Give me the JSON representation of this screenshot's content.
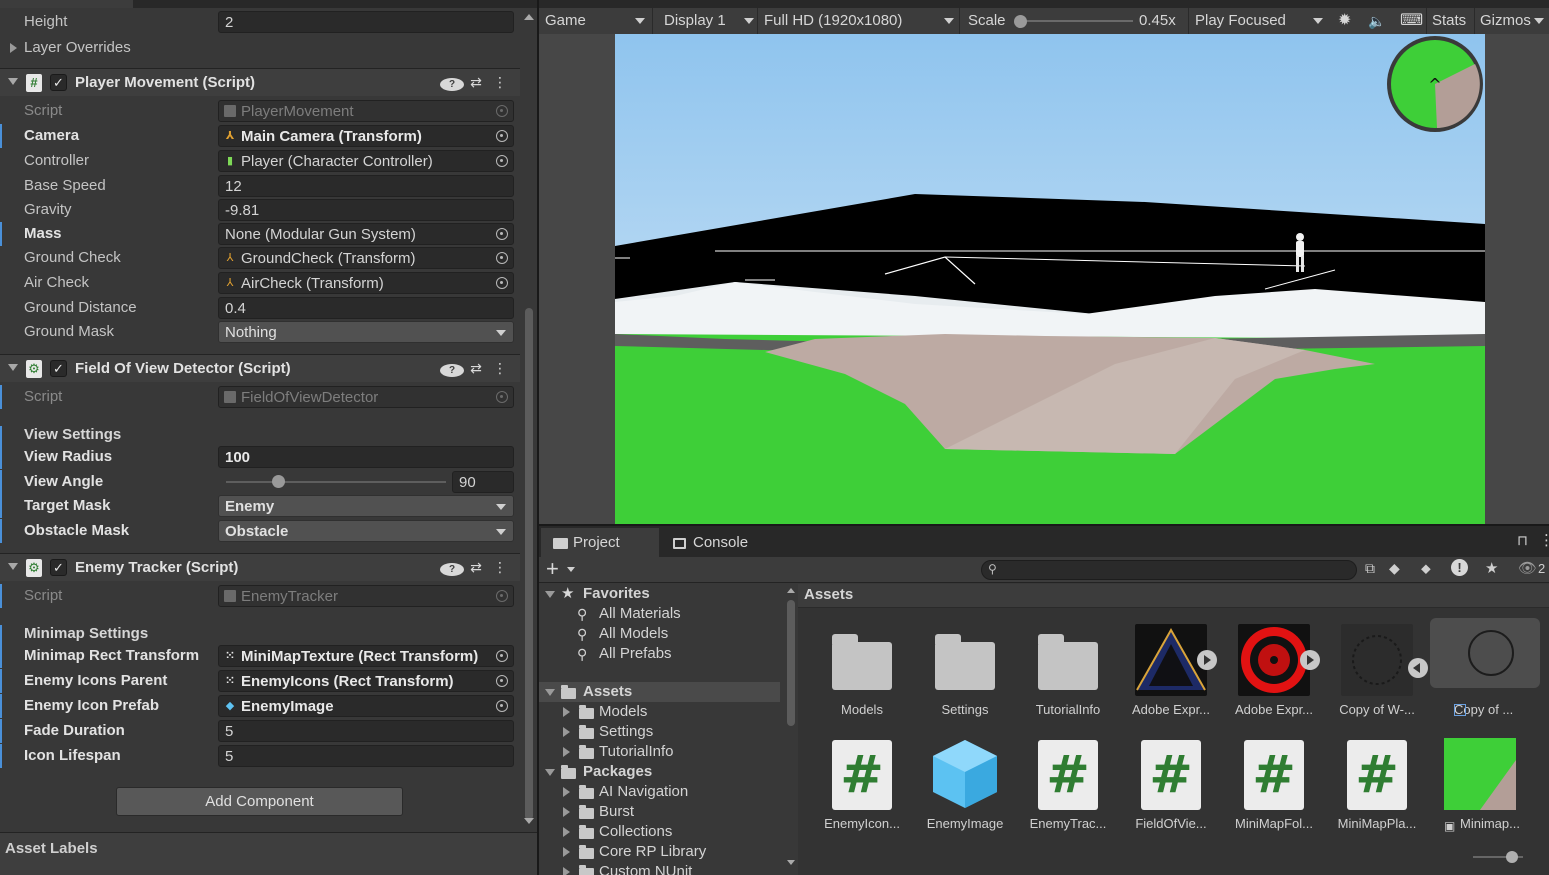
{
  "inspector": {
    "height_row": {
      "label": "Height",
      "value": "2"
    },
    "layer_overrides": "Layer Overrides",
    "player_movement": {
      "title": "Player Movement (Script)",
      "rows": [
        {
          "label": "Script",
          "value": "PlayerMovement"
        },
        {
          "label": "Camera",
          "value": "Main Camera (Transform)"
        },
        {
          "label": "Controller",
          "value": "Player (Character Controller)"
        },
        {
          "label": "Base Speed",
          "value": "12"
        },
        {
          "label": "Gravity",
          "value": "-9.81"
        },
        {
          "label": "Mass",
          "value": "None (Modular Gun System)"
        },
        {
          "label": "Ground Check",
          "value": "GroundCheck (Transform)"
        },
        {
          "label": "Air Check",
          "value": "AirCheck (Transform)"
        },
        {
          "label": "Ground Distance",
          "value": "0.4"
        },
        {
          "label": "Ground Mask",
          "value": "Nothing"
        }
      ]
    },
    "fov_detector": {
      "title": "Field Of View Detector (Script)",
      "script": {
        "label": "Script",
        "value": "FieldOfViewDetector"
      },
      "section": "View Settings",
      "view_radius": {
        "label": "View Radius",
        "value": "100"
      },
      "view_angle": {
        "label": "View Angle",
        "value": "90",
        "slider_fraction": 0.25
      },
      "target_mask": {
        "label": "Target Mask",
        "value": "Enemy"
      },
      "obstacle_mask": {
        "label": "Obstacle Mask",
        "value": "Obstacle"
      }
    },
    "enemy_tracker": {
      "title": "Enemy Tracker (Script)",
      "script": {
        "label": "Script",
        "value": "EnemyTracker"
      },
      "section": "Minimap Settings",
      "rows": [
        {
          "label": "Minimap Rect Transform",
          "value": "MiniMapTexture (Rect Transform)"
        },
        {
          "label": "Enemy Icons Parent",
          "value": "EnemyIcons (Rect Transform)"
        },
        {
          "label": "Enemy Icon Prefab",
          "value": "EnemyImage"
        },
        {
          "label": "Fade Duration",
          "value": "5"
        },
        {
          "label": "Icon Lifespan",
          "value": "5"
        }
      ]
    },
    "add_component": "Add Component",
    "asset_labels": "Asset Labels"
  },
  "game_toolbar": {
    "view": "Game",
    "display": "Display 1",
    "resolution": "Full HD (1920x1080)",
    "scale_label": "Scale",
    "scale_value": "0.45x",
    "play_mode": "Play Focused",
    "stats": "Stats",
    "gizmos": "Gizmos"
  },
  "project": {
    "tabs": [
      "Project",
      "Console"
    ],
    "tree": {
      "favorites": "Favorites",
      "favorite_items": [
        "All Materials",
        "All Models",
        "All Prefabs"
      ],
      "assets": "Assets",
      "asset_folders": [
        "Models",
        "Settings",
        "TutorialInfo"
      ],
      "packages": "Packages",
      "package_items": [
        "AI Navigation",
        "Burst",
        "Collections",
        "Core RP Library",
        "Custom NUnit"
      ]
    },
    "assets_header": "Assets",
    "tiles_row1": [
      "Models",
      "Settings",
      "TutorialInfo",
      "Adobe Expr...",
      "Adobe Expr...",
      "Copy of W-...",
      "Copy of ..."
    ],
    "tiles_row2": [
      "EnemyIcon...",
      "EnemyImage",
      "EnemyTrac...",
      "FieldOfVie...",
      "MiniMapFol...",
      "MiniMapPla...",
      "Minimap..."
    ],
    "visible_count": "2"
  },
  "colors": {
    "accent": "#4a90d9",
    "ground_green": "#3ecf38",
    "sky": "#a9d3f2"
  }
}
